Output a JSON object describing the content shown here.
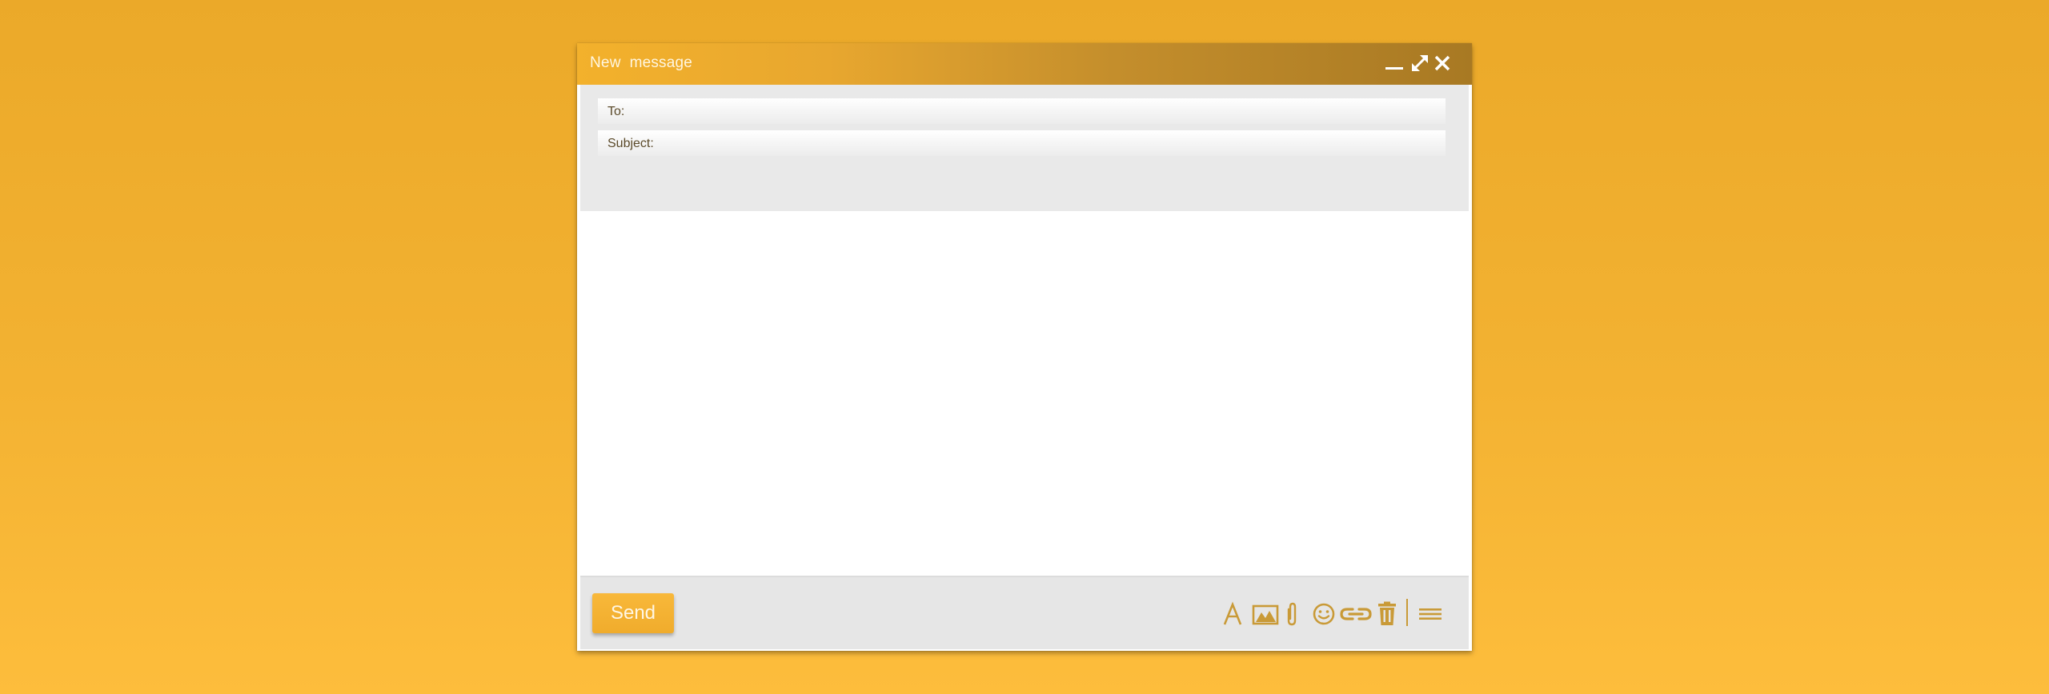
{
  "window": {
    "title": "New  message",
    "controls": {
      "minimize": "minimize-icon",
      "maximize": "expand-icon",
      "close": "close-icon"
    }
  },
  "fields": {
    "to_label": "To:",
    "to_value": "",
    "subject_label": "Subject:",
    "subject_value": ""
  },
  "body": {
    "value": ""
  },
  "footer": {
    "send_label": "Send",
    "toolbar": [
      "font-icon",
      "image-icon",
      "attachment-icon",
      "emoji-icon",
      "link-icon",
      "trash-icon",
      "menu-icon"
    ]
  },
  "colors": {
    "background": "#f3b232",
    "accent": "#c99a37",
    "send_button": "#f0ac2c",
    "title_bar_start": "#f3b12c",
    "title_bar_end": "#a87923"
  }
}
